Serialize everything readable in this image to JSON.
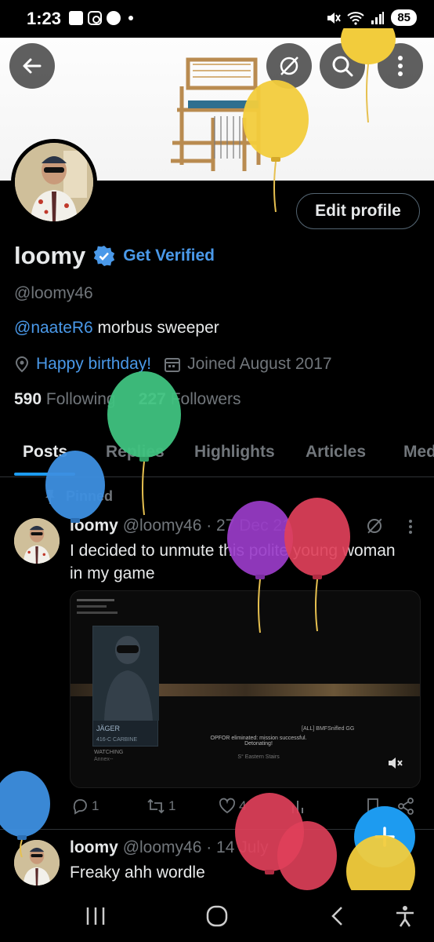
{
  "status_bar": {
    "time": "1:23",
    "battery": "85"
  },
  "profile": {
    "name": "loomy",
    "get_verified": "Get Verified",
    "handle": "@loomy46",
    "bio_mention": "@naateR6",
    "bio_rest": " morbus sweeper",
    "birthday": "Happy birthday!",
    "joined": "Joined August 2017",
    "following_count": "590",
    "following_label": "Following",
    "followers_count": "227",
    "followers_label": "Followers",
    "edit_profile": "Edit profile"
  },
  "tabs": [
    {
      "label": "Posts",
      "active": true
    },
    {
      "label": "Replies"
    },
    {
      "label": "Highlights"
    },
    {
      "label": "Articles"
    },
    {
      "label": "Med"
    }
  ],
  "pinned_label": "Pinned",
  "posts": [
    {
      "name": "loomy",
      "meta": "@loomy46 · 27 Dec 21",
      "text_line1": "I decided to unmute this polite young woman",
      "text_line2": "in my game",
      "media": {
        "operator": "JÄGER",
        "weapon": "416-C CARBINE",
        "watching_label": "WATCHING",
        "watching_name": "Annex--",
        "center_msg_1": "OPFOR eliminated: mission successful.",
        "center_msg_2": "Detonating!",
        "region": "S° Eastern Stairs",
        "chat_tag": "[ALL] BMFSnifled GG"
      },
      "stats": {
        "replies": "1",
        "reposts": "1",
        "likes": "4"
      }
    },
    {
      "name": "loomy",
      "meta": "@loomy46 · 14 July",
      "text_line1": "Freaky ahh wordle"
    }
  ],
  "colors": {
    "accent": "#1d9bf0",
    "link": "#4a99e9",
    "muted": "#71767b",
    "text": "#e7e9ea",
    "background": "#000000",
    "balloon_yellow": "#f2cc3c",
    "balloon_green": "#3fc27f",
    "balloon_blue": "#3d8fe0",
    "balloon_purple": "#9a3cc9",
    "balloon_red": "#e0405a"
  },
  "icons": [
    "back-arrow-icon",
    "grok-icon",
    "search-icon",
    "more-vertical-icon",
    "verified-badge-icon",
    "location-icon",
    "calendar-icon",
    "pin-icon",
    "mute-icon",
    "reply-icon",
    "repost-icon",
    "like-icon",
    "views-icon",
    "bookmark-icon",
    "share-icon",
    "plus-icon"
  ]
}
